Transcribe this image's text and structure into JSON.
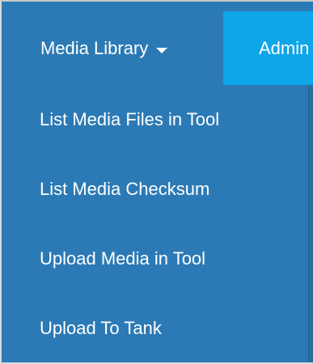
{
  "nav": {
    "media_library_label": "Media Library",
    "admin_label": "Admin"
  },
  "dropdown": {
    "items": [
      {
        "label": "List Media Files in Tool"
      },
      {
        "label": "List Media Checksum"
      },
      {
        "label": "Upload Media in Tool"
      },
      {
        "label": "Upload To Tank"
      }
    ]
  },
  "colors": {
    "nav_bg": "#2c7ab5",
    "admin_bg": "#0ea5e9",
    "text": "#ffffff"
  }
}
